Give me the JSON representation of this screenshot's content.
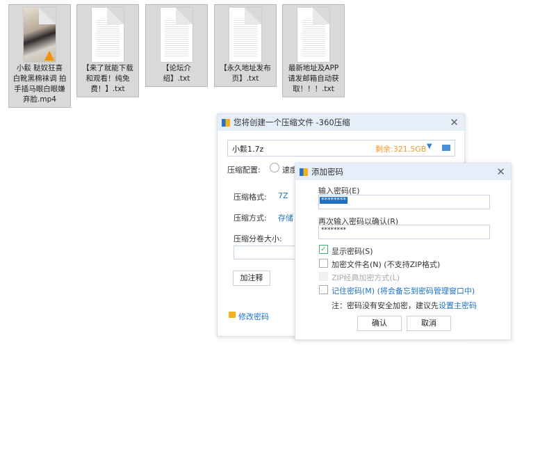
{
  "files": [
    {
      "name": "小鬏 鞑奴狂喜 白靴黑棉袜调 拍手插马眼白眼嫌弃脸.mp4",
      "type": "video"
    },
    {
      "name": "【来了就能下载和观看！纯免费！】.txt",
      "type": "text"
    },
    {
      "name": "【论坛介绍】.txt",
      "type": "text"
    },
    {
      "name": "【永久地址发布页】.txt",
      "type": "text"
    },
    {
      "name": "最新地址及APP请发邮箱自动获取！！！.txt",
      "type": "text"
    }
  ],
  "main_dialog": {
    "title": "您将创建一个压缩文件 -360压缩",
    "filename": "小鬏1.7z",
    "free_space": "剩余:321.5GB",
    "config_label": "压缩配置:",
    "config_option": "速度",
    "format_label": "压缩格式:",
    "format_value": "7Z",
    "method_label": "压缩方式:",
    "method_value": "存储",
    "split_label": "压缩分卷大小:",
    "split_value": "",
    "comment_button": "加注释",
    "change_password": "修改密码",
    "accent": "#f29a2e"
  },
  "password_dialog": {
    "title": "添加密码",
    "enter_label": "输入密码(E)",
    "enter_value": "********",
    "confirm_label": "再次输入密码以确认(R)",
    "confirm_value": "********",
    "show_password": {
      "label": "显示密码(S)",
      "checked": true
    },
    "encrypt_names": {
      "label": "加密文件名(N) (不支持ZIP格式)",
      "checked": false
    },
    "zip_classic": {
      "label": "ZIP经典加密方式(L)",
      "checked": false,
      "disabled": true
    },
    "remember": {
      "label": "记住密码(M) (将会备忘到密码管理窗口中)",
      "checked": false
    },
    "note": "注：密码没有安全加密，建议先",
    "note_link": "设置主密码",
    "ok": "确认",
    "cancel": "取消"
  }
}
